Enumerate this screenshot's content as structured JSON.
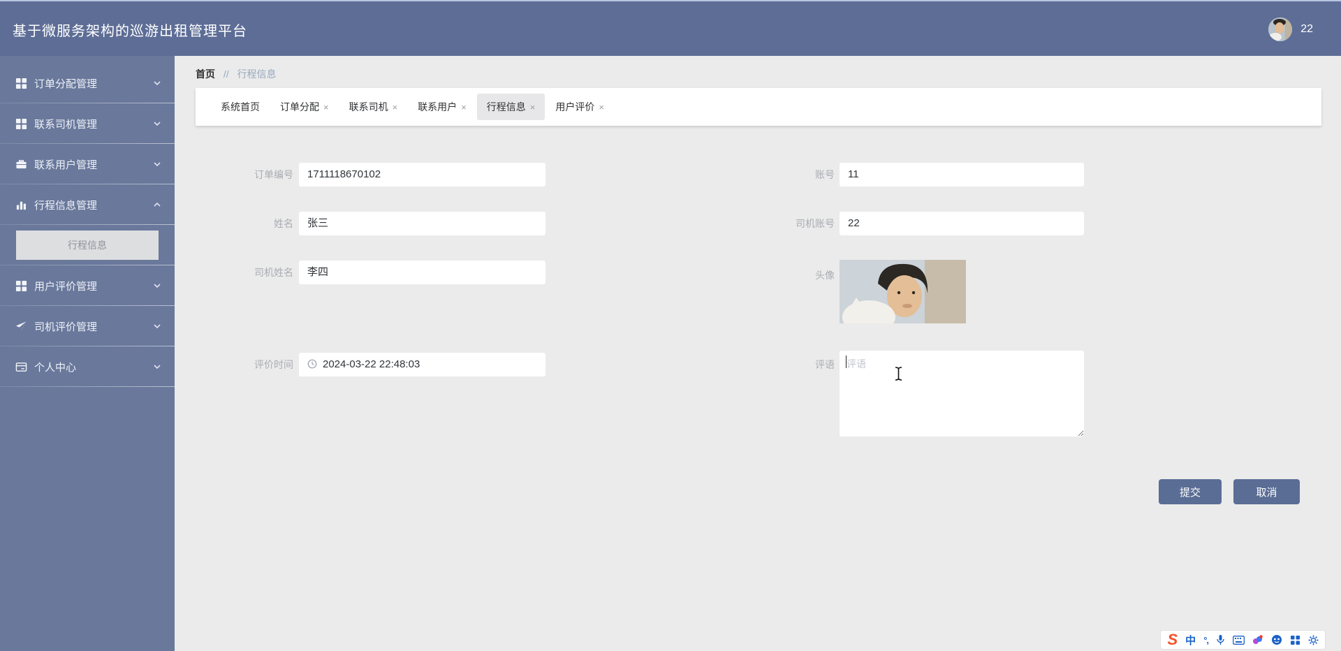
{
  "header": {
    "title": "基于微服务架构的巡游出租管理平台",
    "username": "22"
  },
  "sidebar": {
    "items": [
      {
        "label": "订单分配管理",
        "icon": "grid-icon"
      },
      {
        "label": "联系司机管理",
        "icon": "grid-icon"
      },
      {
        "label": "联系用户管理",
        "icon": "briefcase-icon"
      },
      {
        "label": "行程信息管理",
        "icon": "bar-chart-icon",
        "expanded": true
      },
      {
        "label": "用户评价管理",
        "icon": "grid-icon"
      },
      {
        "label": "司机评价管理",
        "icon": "send-icon"
      },
      {
        "label": "个人中心",
        "icon": "card-icon"
      }
    ],
    "submenu": {
      "label": "行程信息",
      "active": true
    }
  },
  "breadcrumb": {
    "home": "首页",
    "separator": "//",
    "current": "行程信息"
  },
  "tabs": [
    {
      "label": "系统首页",
      "closable": false,
      "active": false
    },
    {
      "label": "订单分配",
      "closable": true,
      "active": false
    },
    {
      "label": "联系司机",
      "closable": true,
      "active": false
    },
    {
      "label": "联系用户",
      "closable": true,
      "active": false
    },
    {
      "label": "行程信息",
      "closable": true,
      "active": true
    },
    {
      "label": "用户评价",
      "closable": true,
      "active": false
    }
  ],
  "tab_close_glyph": "×",
  "form": {
    "order_no": {
      "label": "订单编号",
      "value": "1711118670102"
    },
    "account": {
      "label": "账号",
      "value": "11"
    },
    "name": {
      "label": "姓名",
      "value": "张三"
    },
    "driver_account": {
      "label": "司机账号",
      "value": "22"
    },
    "driver_name": {
      "label": "司机姓名",
      "value": "李四"
    },
    "avatar": {
      "label": "头像"
    },
    "eval_time": {
      "label": "评价时间",
      "value": "2024-03-22 22:48:03"
    },
    "comment": {
      "label": "评语",
      "placeholder": "评语",
      "value": ""
    }
  },
  "actions": {
    "submit": "提交",
    "cancel": "取消"
  },
  "ime": {
    "logo": "S",
    "mode": "中",
    "punctuation": "°,"
  },
  "colors": {
    "header_bg": "#5d6d96",
    "sidebar_bg": "#69789b",
    "main_bg": "#ebebeb",
    "active_submenu_bg": "#dcdee0",
    "active_tab_bg": "#e7e7e9",
    "button_bg": "#5a6d95",
    "ime_logo": "#f4502a",
    "ime_icon": "#1a62c8"
  }
}
